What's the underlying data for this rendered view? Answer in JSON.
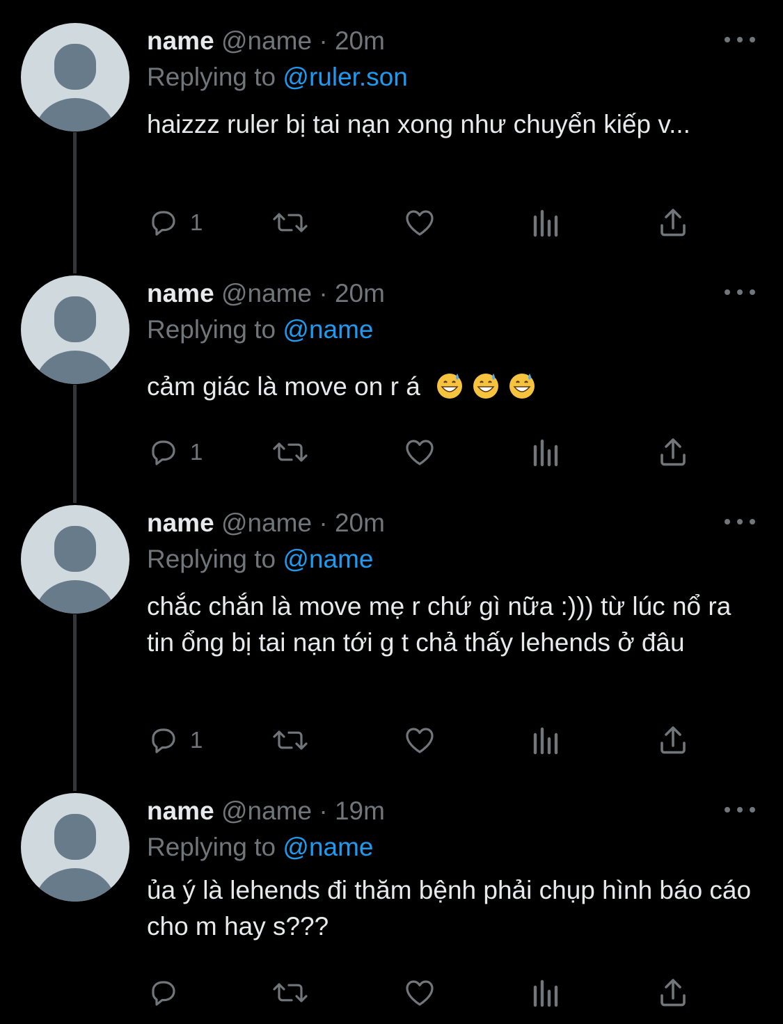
{
  "tweets": [
    {
      "name": "name",
      "handle": "@name",
      "dot": "·",
      "time": "20m",
      "replying_prefix": "Replying to",
      "replying_to": "@ruler.son",
      "text": "haizzz ruler bị tai nạn xong như chuyển kiếp v...",
      "reply_count": "1"
    },
    {
      "name": "name",
      "handle": "@name",
      "dot": "·",
      "time": "20m",
      "replying_prefix": "Replying to",
      "replying_to": "@name",
      "text": "cảm giác là move on r á",
      "emojis": [
        "grinning-sweat-emoji",
        "grinning-sweat-emoji",
        "grinning-sweat-emoji"
      ],
      "reply_count": "1"
    },
    {
      "name": "name",
      "handle": "@name",
      "dot": "·",
      "time": "20m",
      "replying_prefix": "Replying to",
      "replying_to": "@name",
      "text": "chắc chắn là move mẹ r chứ gì nữa :))) từ lúc nổ ra tin ổng bị tai nạn tới g t chả thấy lehends ở đâu",
      "reply_count": "1"
    },
    {
      "name": "name",
      "handle": "@name",
      "dot": "·",
      "time": "19m",
      "replying_prefix": "Replying to",
      "replying_to": "@name",
      "text": "ủa ý là lehends đi thăm bệnh phải chụp hình báo cáo cho m hay s???",
      "reply_count": ""
    }
  ],
  "icons": {
    "reply": "reply-icon",
    "retweet": "retweet-icon",
    "like": "heart-icon",
    "views": "views-icon",
    "share": "share-icon",
    "more": "more-icon"
  },
  "colors": {
    "background": "#000000",
    "text": "#e7e9ea",
    "secondary": "#71767b",
    "mention": "#1d9bf0",
    "avatar_bg": "#cfd9de",
    "avatar_figure": "#687b8a",
    "thread_line": "#333639"
  }
}
